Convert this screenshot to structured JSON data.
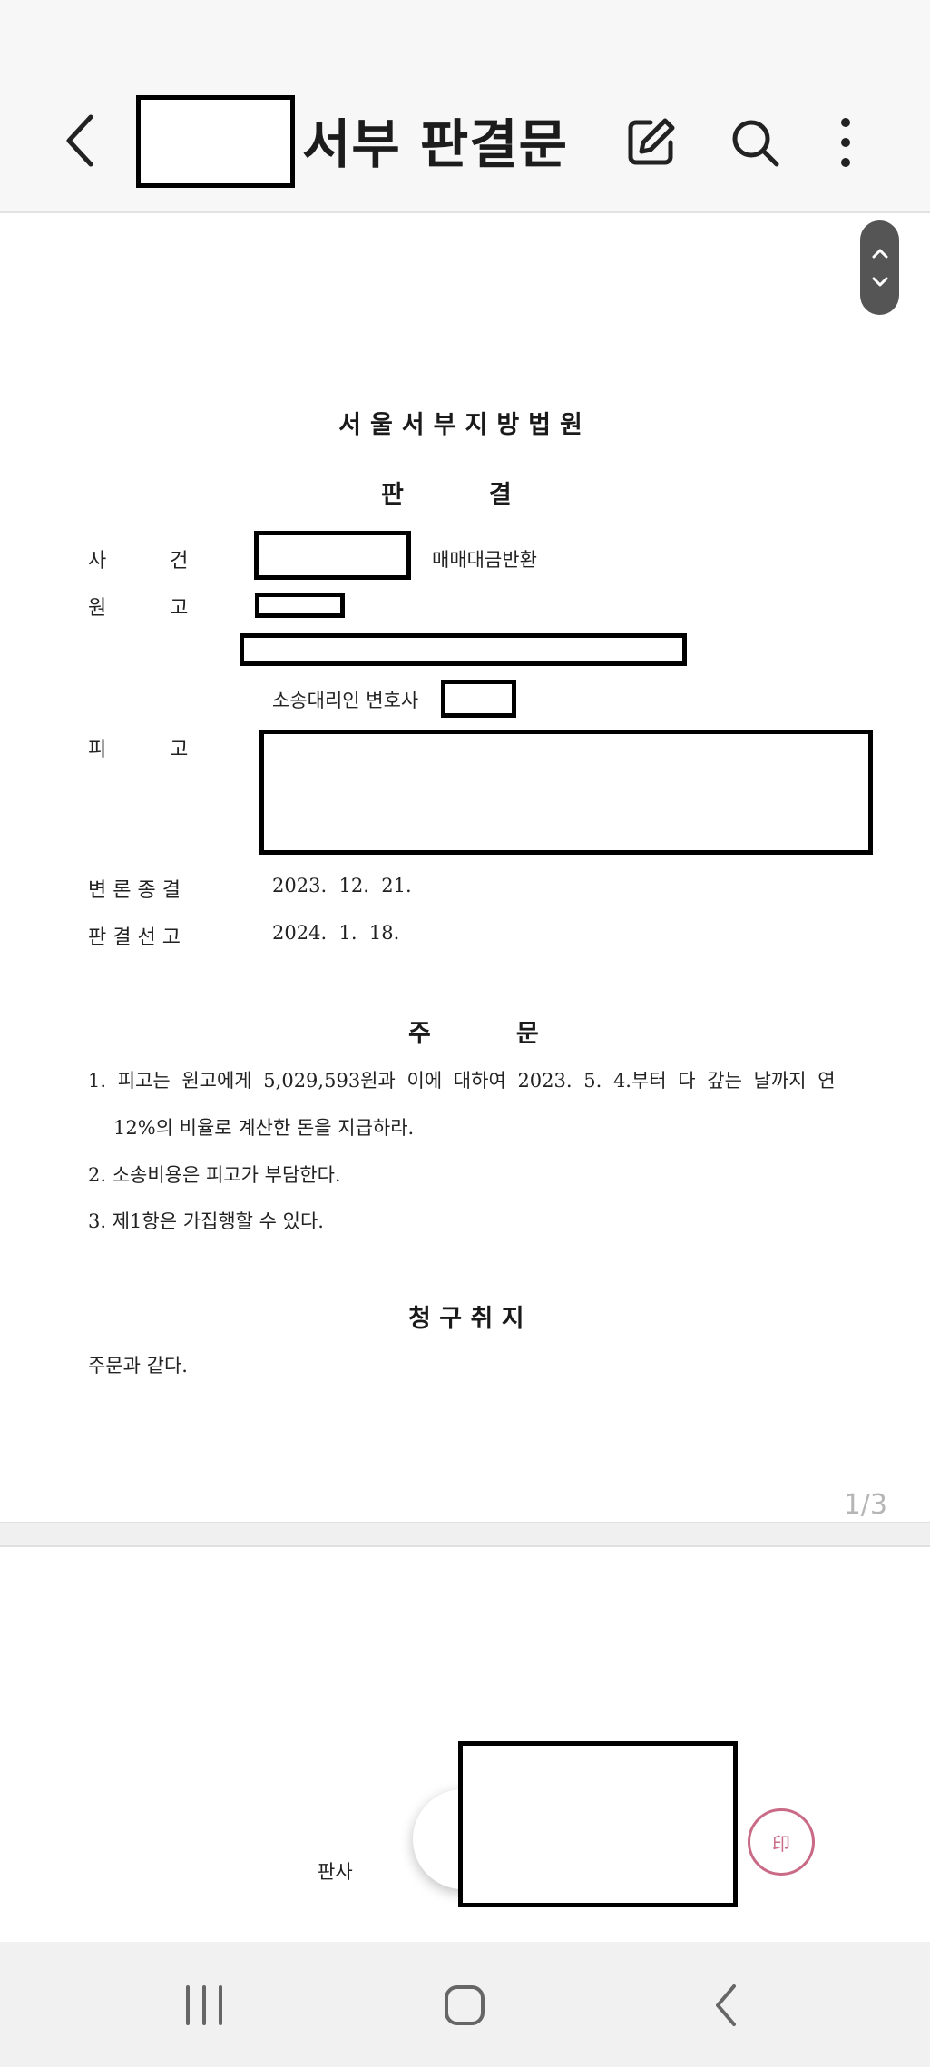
{
  "app_bar": {
    "title": "서부 판결문",
    "icons": [
      "back-icon",
      "edit-icon",
      "search-icon",
      "more-icon"
    ]
  },
  "document": {
    "court": "서울서부지방법원",
    "type_heading": "판          결",
    "case_label": "사          건",
    "case_type": "매매대금반환",
    "plaintiff_label": "원          고",
    "attorney_label": "소송대리인 변호사",
    "defendant_label": "피          고",
    "closing_label": "변 론 종 결",
    "closing_date": "2023.  12.  21.",
    "ruling_label": "판 결 선 고",
    "ruling_date": "2024.  1.  18.",
    "order_heading": "주          문",
    "orders": [
      "1. 피고는 원고에게 5,029,593원과 이에 대하여 2023. 5. 4.부터 다 갚는 날까지 연",
      "12%의 비율로 계산한 돈을 지급하라.",
      "2. 소송비용은 피고가 부담한다.",
      "3. 제1항은 가집행할 수 있다."
    ],
    "claim_heading": "청 구 취 지",
    "claim_text": "주문과 같다.",
    "page_indicator": "1/3",
    "judge_label": "판사"
  },
  "colors": {
    "seal": "#c96b86",
    "page_number": "#b5b5b5"
  },
  "nav_bar": {
    "icons": [
      "recent-apps-icon",
      "home-icon",
      "back-nav-icon"
    ]
  }
}
